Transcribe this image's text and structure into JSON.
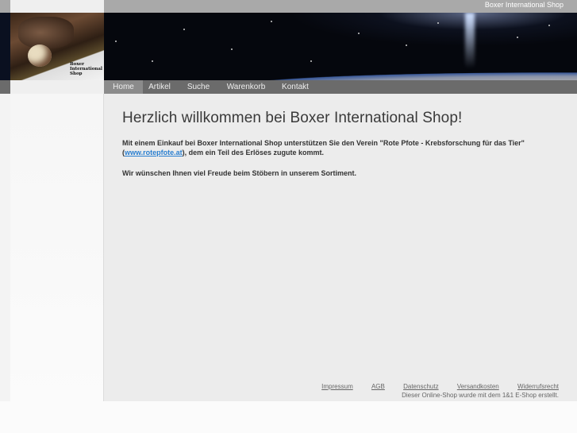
{
  "header": {
    "site_title": "Boxer International Shop",
    "logo_text": [
      "Boxer",
      "International",
      "Shop"
    ]
  },
  "nav": [
    {
      "label": "Home",
      "active": true
    },
    {
      "label": "Artikel"
    },
    {
      "label": "Suche"
    },
    {
      "label": "Warenkorb"
    },
    {
      "label": "Kontakt"
    }
  ],
  "main": {
    "heading": "Herzlich willkommen bei Boxer International Shop!",
    "para1_text": "Mit einem Einkauf bei Boxer International Shop unterstützen Sie den Verein \"Rote Pfote - Krebsforschung für das Tier\"",
    "para1_open": "(",
    "para1_link": "www.rotepfote.at",
    "para1_rest": "), dem ein Teil des Erlöses zugute kommt.",
    "para2": "Wir wünschen Ihnen viel Freude beim Stöbern in unserem Sortiment."
  },
  "footer": {
    "links": [
      "Impressum",
      "AGB",
      "Datenschutz",
      "Versandkosten",
      "Widerrufsrecht"
    ],
    "note": "Dieser Online-Shop wurde mit dem 1&1 E-Shop erstellt."
  }
}
